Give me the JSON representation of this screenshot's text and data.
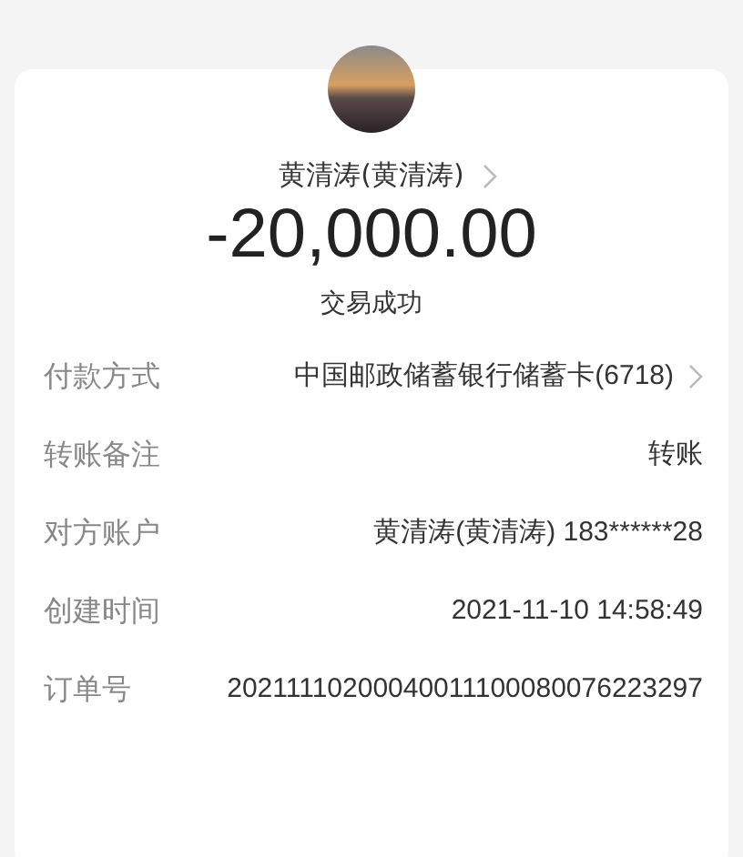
{
  "payee": {
    "name": "黄清涛(黄清涛)"
  },
  "amount": "-20,000.00",
  "status": "交易成功",
  "details": [
    {
      "label": "付款方式",
      "value": "中国邮政储蓄银行储蓄卡(6718)",
      "kind": "link"
    },
    {
      "label": "转账备注",
      "value": "转账",
      "kind": "plain"
    },
    {
      "label": "对方账户",
      "value": "黄清涛(黄清涛) 183******28",
      "kind": "plain"
    },
    {
      "label": "创建时间",
      "value": "2021-11-10 14:58:49",
      "kind": "plain"
    },
    {
      "label": "订单号",
      "value": "20211110200040011100080076223297",
      "kind": "plain"
    }
  ]
}
